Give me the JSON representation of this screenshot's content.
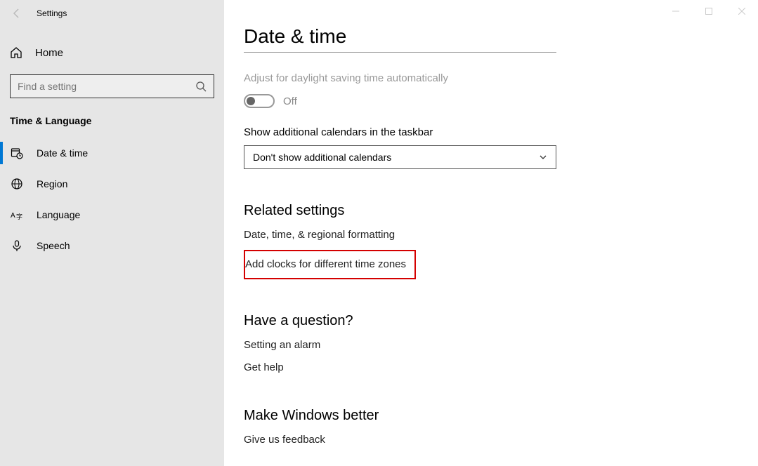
{
  "app_title": "Settings",
  "sidebar": {
    "home": "Home",
    "search_placeholder": "Find a setting",
    "category": "Time & Language",
    "items": [
      {
        "label": "Date & time"
      },
      {
        "label": "Region"
      },
      {
        "label": "Language"
      },
      {
        "label": "Speech"
      }
    ]
  },
  "page": {
    "title": "Date & time",
    "dst_label": "Adjust for daylight saving time automatically",
    "dst_state": "Off",
    "additional_calendars_label": "Show additional calendars in the taskbar",
    "additional_calendars_value": "Don't show additional calendars",
    "related_heading": "Related settings",
    "related_link_1": "Date, time, & regional formatting",
    "related_link_2": "Add clocks for different time zones",
    "question_heading": "Have a question?",
    "question_link_1": "Setting an alarm",
    "question_link_2": "Get help",
    "better_heading": "Make Windows better",
    "better_link_1": "Give us feedback"
  }
}
